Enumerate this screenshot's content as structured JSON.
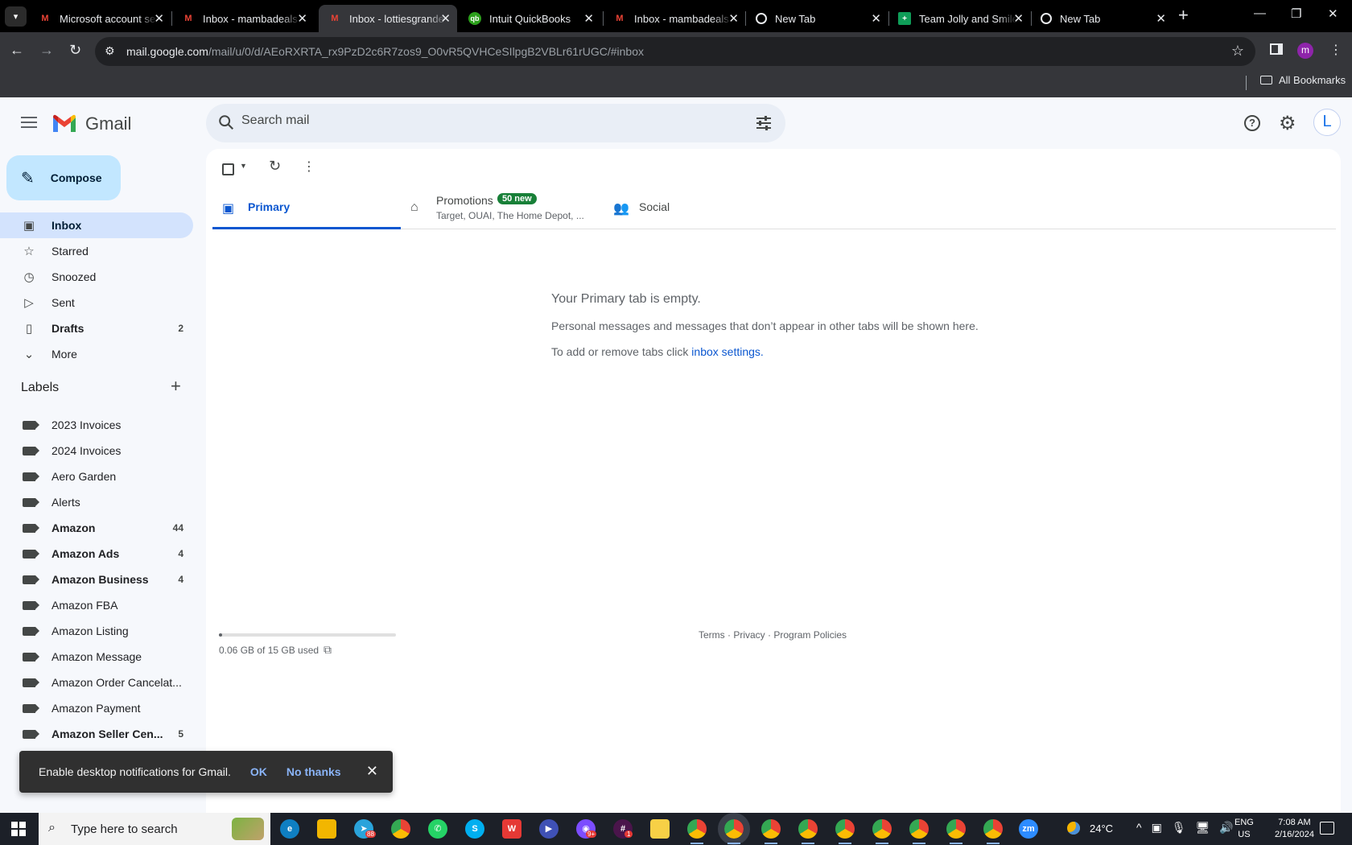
{
  "browser": {
    "tabs": [
      {
        "title": "Microsoft account se",
        "icon": "gmail-icon"
      },
      {
        "title": "Inbox - mambadeals",
        "icon": "gmail-icon"
      },
      {
        "title": "Inbox - lottiesgrande",
        "icon": "gmail-icon",
        "active": true
      },
      {
        "title": "Intuit QuickBooks",
        "icon": "quickbooks-icon"
      },
      {
        "title": "Inbox - mambadeals",
        "icon": "gmail-icon"
      },
      {
        "title": "New Tab",
        "icon": "chrome-icon"
      },
      {
        "title": "Team Jolly and Smile",
        "icon": "sheets-icon"
      },
      {
        "title": "New Tab",
        "icon": "chrome-icon"
      }
    ],
    "url_host": "mail.google.com",
    "url_path": "/mail/u/0/d/AEoRXRTA_rx9PzD2c6R7zos9_O0vR5QVHCeSIlpgB2VBLr61rUGC/#inbox",
    "profile_initial": "m",
    "bookmarks_folder": "All Bookmarks"
  },
  "gmail": {
    "brand": "Gmail",
    "search_placeholder": "Search mail",
    "avatar_initial": "L",
    "compose_label": "Compose",
    "nav": [
      {
        "label": "Inbox",
        "icon": "inbox-icon",
        "active": true
      },
      {
        "label": "Starred",
        "icon": "star-icon"
      },
      {
        "label": "Snoozed",
        "icon": "clock-icon"
      },
      {
        "label": "Sent",
        "icon": "send-icon"
      },
      {
        "label": "Drafts",
        "icon": "draft-icon",
        "count": "2",
        "bold": true
      },
      {
        "label": "More",
        "icon": "chevron-down-icon"
      }
    ],
    "labels_heading": "Labels",
    "labels": [
      {
        "label": "2023 Invoices"
      },
      {
        "label": "2024 Invoices"
      },
      {
        "label": "Aero Garden"
      },
      {
        "label": "Alerts"
      },
      {
        "label": "Amazon",
        "count": "44",
        "bold": true
      },
      {
        "label": "Amazon Ads",
        "count": "4",
        "bold": true
      },
      {
        "label": "Amazon Business",
        "count": "4",
        "bold": true
      },
      {
        "label": "Amazon FBA"
      },
      {
        "label": "Amazon Listing"
      },
      {
        "label": "Amazon Message"
      },
      {
        "label": "Amazon Order Cancelat..."
      },
      {
        "label": "Amazon Payment"
      },
      {
        "label": "Amazon Seller Cen...",
        "count": "5",
        "bold": true
      }
    ],
    "tabs": {
      "primary": "Primary",
      "promotions": "Promotions",
      "promotions_badge": "50 new",
      "promotions_senders": "Target, OUAI, The Home Depot, ...",
      "social": "Social"
    },
    "empty_state": {
      "title": "Your Primary tab is empty.",
      "line1": "Personal messages and messages that don’t appear in other tabs will be shown here.",
      "line2_prefix": "To add or remove tabs click ",
      "line2_link": "inbox settings."
    },
    "storage": {
      "text": "0.06 GB of 15 GB used",
      "fraction": 0.004
    },
    "footer": {
      "terms": "Terms",
      "privacy": "Privacy",
      "policies": "Program Policies",
      "sep": " · "
    },
    "snackbar": {
      "message": "Enable desktop notifications for Gmail.",
      "ok": "OK",
      "no_thanks": "No thanks"
    }
  },
  "taskbar": {
    "search_text": "Type here to search",
    "apps": [
      "edge-icon",
      "file-explorer-icon",
      "telegram-icon",
      "chrome-icon",
      "whatsapp-icon",
      "skype-icon",
      "wps-icon",
      "video-icon",
      "discord-icon",
      "slack-icon",
      "sticky-notes-icon",
      "chrome-profile-icon",
      "chrome-profile-icon",
      "chrome-profile-icon",
      "chrome-profile-icon",
      "chrome-profile-icon",
      "chrome-profile-icon",
      "chrome-profile-icon",
      "chrome-profile-icon",
      "chrome-profile-icon",
      "zoom-icon"
    ],
    "zoom_label": "zm",
    "telegram_badge": "88",
    "discord_badge": "9+",
    "slack_badge": "1",
    "temperature": "24°C",
    "lang": "ENG",
    "region": "US",
    "time": "7:08 AM",
    "date": "2/16/2024"
  }
}
